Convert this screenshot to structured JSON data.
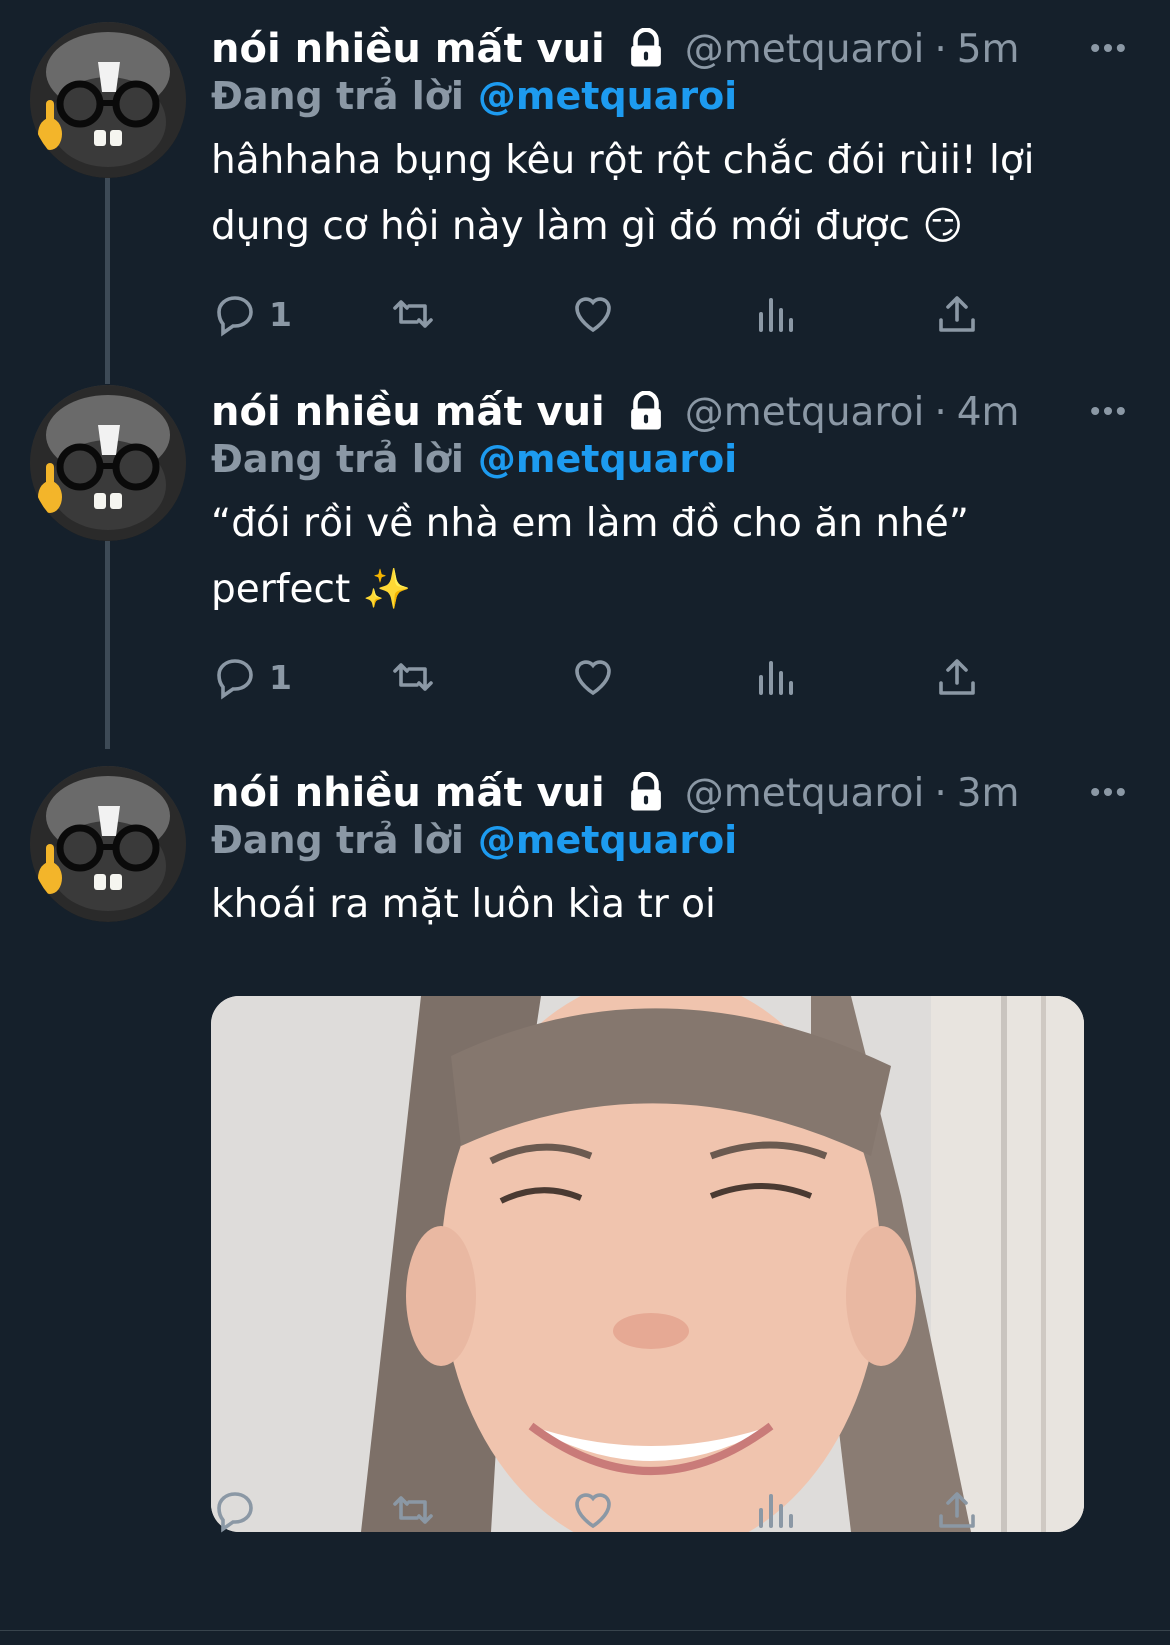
{
  "colors": {
    "background": "#15202b",
    "secondary_text": "#8b98a5",
    "link_blue": "#1d9bf0",
    "thread_line": "#3d4a56"
  },
  "tweets": [
    {
      "display_name": "nói nhiều mất vui",
      "handle": "@metquaroi",
      "separator": "·",
      "time": "5m",
      "reply_prefix": "Đang trả lời",
      "reply_handle": "@metquaroi",
      "text_line1": "hâhhaha bụng kêu rột rột chắc đói rùii! lợi",
      "text_line2": "dụng cơ hội này làm gì đó mới được 😏",
      "reply_count": "1",
      "icons": [
        "lock-icon",
        "more-icon",
        "reply-icon",
        "retweet-icon",
        "like-icon",
        "analytics-icon",
        "share-icon"
      ]
    },
    {
      "display_name": "nói nhiều mất vui",
      "handle": "@metquaroi",
      "separator": "·",
      "time": "4m",
      "reply_prefix": "Đang trả lời",
      "reply_handle": "@metquaroi",
      "text_line1": "“đói rồi về nhà em làm đồ cho ăn nhé”",
      "text_line2": "perfect ✨",
      "reply_count": "1",
      "icons": [
        "lock-icon",
        "more-icon",
        "reply-icon",
        "retweet-icon",
        "like-icon",
        "analytics-icon",
        "share-icon"
      ]
    },
    {
      "display_name": "nói nhiều mất vui",
      "handle": "@metquaroi",
      "separator": "·",
      "time": "3m",
      "reply_prefix": "Đang trả lời",
      "reply_handle": "@metquaroi",
      "text_line1": "khoái ra mặt luôn kìa tr oi",
      "has_media": true,
      "reply_count": "",
      "icons": [
        "lock-icon",
        "more-icon",
        "reply-icon",
        "retweet-icon",
        "like-icon",
        "analytics-icon",
        "share-icon"
      ]
    }
  ]
}
